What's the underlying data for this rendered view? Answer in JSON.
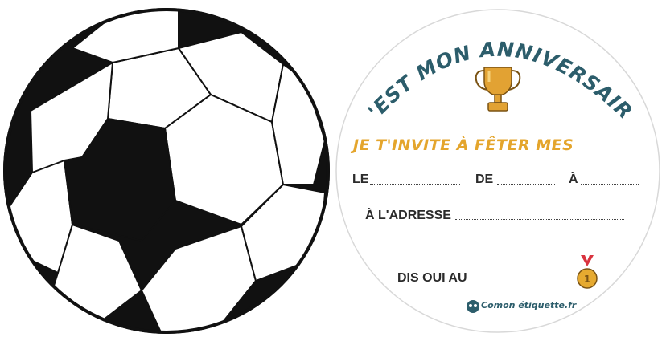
{
  "card": {
    "title": "C'EST MON ANNIVERSAIRE",
    "invite_line": "JE T'INVITE À FÊTER MES",
    "fields": {
      "le": "LE",
      "de": "DE",
      "a": "À",
      "adresse": "À L'ADRESSE",
      "dis_oui": "DIS OUI AU"
    },
    "logo": "Comon étiquette.fr"
  },
  "colors": {
    "title": "#2c5d6b",
    "invite": "#e4a52c",
    "trophy": "#e2a233",
    "ball_black": "#111111"
  },
  "icons": {
    "trophy": "trophy-icon",
    "medal": "medal-icon",
    "ball": "soccer-ball-icon",
    "logo": "comon-logo-icon"
  }
}
